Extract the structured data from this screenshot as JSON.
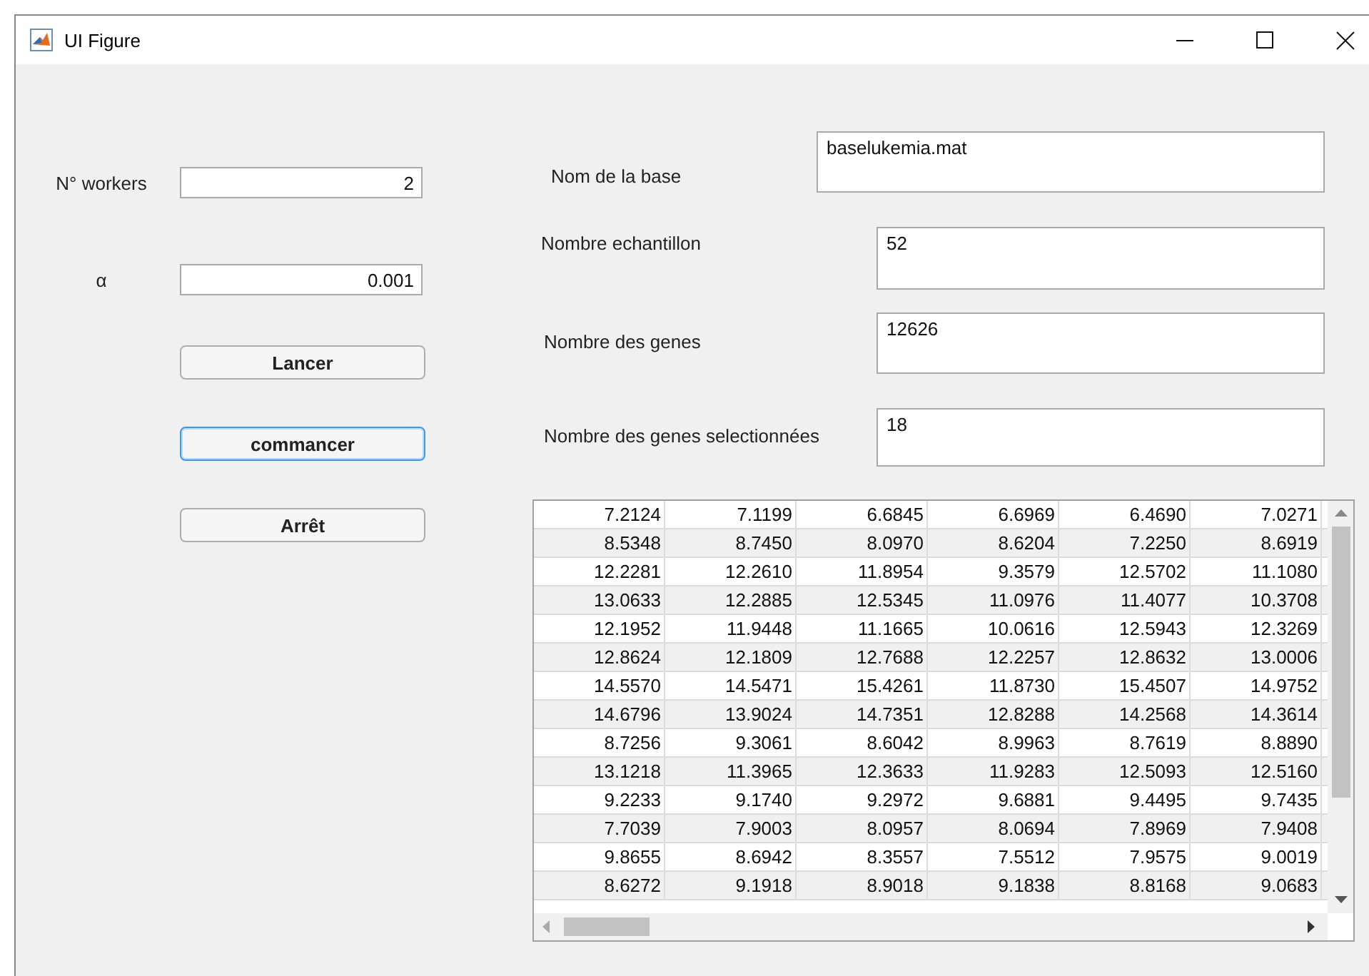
{
  "window": {
    "title": "UI Figure"
  },
  "left_fields": [
    {
      "label": "N° workers",
      "value": "2"
    },
    {
      "label": "α",
      "value": "0.001"
    }
  ],
  "buttons": [
    {
      "label": "Lancer",
      "focused": false
    },
    {
      "label": "commancer",
      "focused": true
    },
    {
      "label": "Arrêt",
      "focused": false
    }
  ],
  "info_fields": [
    {
      "label": "Nom de la base",
      "value": "baselukemia.mat"
    },
    {
      "label": "Nombre echantillon",
      "value": "52"
    },
    {
      "label": "Nombre des genes",
      "value": "12626"
    },
    {
      "label": "Nombre des genes selectionnées",
      "value": "18"
    }
  ],
  "table": {
    "rows": [
      [
        "7.2124",
        "7.1199",
        "6.6845",
        "6.6969",
        "6.4690",
        "7.0271"
      ],
      [
        "8.5348",
        "8.7450",
        "8.0970",
        "8.6204",
        "7.2250",
        "8.6919"
      ],
      [
        "12.2281",
        "12.2610",
        "11.8954",
        "9.3579",
        "12.5702",
        "11.1080"
      ],
      [
        "13.0633",
        "12.2885",
        "12.5345",
        "11.0976",
        "11.4077",
        "10.3708"
      ],
      [
        "12.1952",
        "11.9448",
        "11.1665",
        "10.0616",
        "12.5943",
        "12.3269"
      ],
      [
        "12.8624",
        "12.1809",
        "12.7688",
        "12.2257",
        "12.8632",
        "13.0006"
      ],
      [
        "14.5570",
        "14.5471",
        "15.4261",
        "11.8730",
        "15.4507",
        "14.9752"
      ],
      [
        "14.6796",
        "13.9024",
        "14.7351",
        "12.8288",
        "14.2568",
        "14.3614"
      ],
      [
        "8.7256",
        "9.3061",
        "8.6042",
        "8.9963",
        "8.7619",
        "8.8890"
      ],
      [
        "13.1218",
        "11.3965",
        "12.3633",
        "11.9283",
        "12.5093",
        "12.5160"
      ],
      [
        "9.2233",
        "9.1740",
        "9.2972",
        "9.6881",
        "9.4495",
        "9.7435"
      ],
      [
        "7.7039",
        "7.9003",
        "8.0957",
        "8.0694",
        "7.8969",
        "7.9408"
      ],
      [
        "9.8655",
        "8.6942",
        "8.3557",
        "7.5512",
        "7.9575",
        "9.0019"
      ],
      [
        "8.6272",
        "9.1918",
        "8.9018",
        "9.1838",
        "8.8168",
        "9.0683"
      ]
    ]
  }
}
